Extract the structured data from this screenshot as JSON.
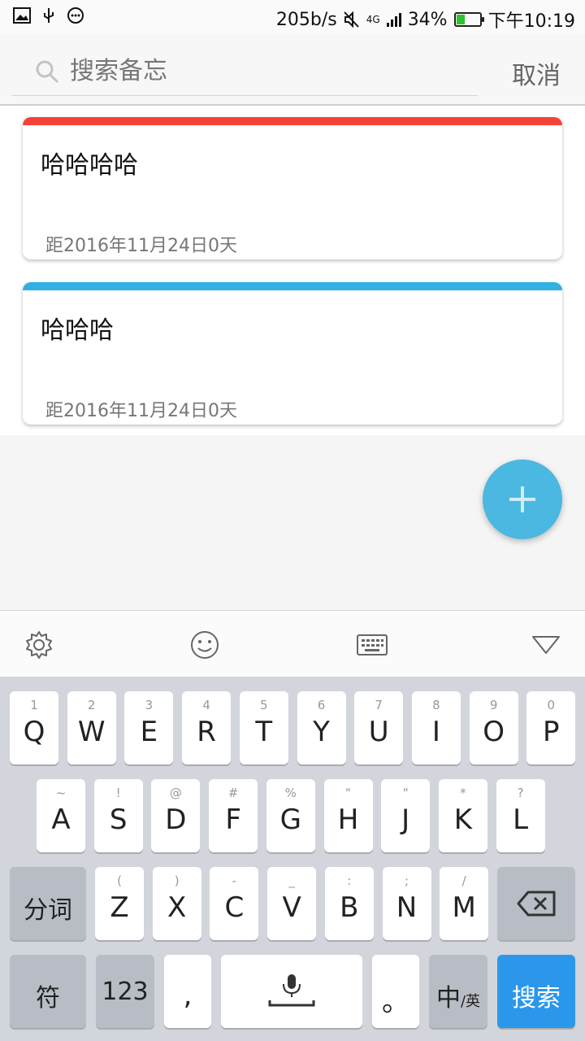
{
  "status_bar": {
    "speed": "205b/s",
    "network": "4G",
    "battery_pct": "34%",
    "battery_level": 0.34,
    "time": "下午10:19"
  },
  "search": {
    "placeholder": "搜索备忘",
    "value": "",
    "cancel_label": "取消"
  },
  "notes": [
    {
      "title": "哈哈哈哈",
      "meta": "距2016年11月24日0天",
      "color": "#f44336"
    },
    {
      "title": "哈哈哈",
      "meta": "距2016年11月24日0天",
      "color": "#2fb1e4"
    }
  ],
  "fab": {
    "icon": "plus-icon",
    "color": "#4ab8e0"
  },
  "keyboard_toolbar": {
    "icons": [
      "gear-icon",
      "emoji-icon",
      "keyboard-icon",
      "collapse-icon"
    ]
  },
  "keyboard": {
    "row1": [
      {
        "hint": "1",
        "key": "Q"
      },
      {
        "hint": "2",
        "key": "W"
      },
      {
        "hint": "3",
        "key": "E"
      },
      {
        "hint": "4",
        "key": "R"
      },
      {
        "hint": "5",
        "key": "T"
      },
      {
        "hint": "6",
        "key": "Y"
      },
      {
        "hint": "7",
        "key": "U"
      },
      {
        "hint": "8",
        "key": "I"
      },
      {
        "hint": "9",
        "key": "O"
      },
      {
        "hint": "0",
        "key": "P"
      }
    ],
    "row2": [
      {
        "hint": "~",
        "key": "A"
      },
      {
        "hint": "!",
        "key": "S"
      },
      {
        "hint": "@",
        "key": "D"
      },
      {
        "hint": "#",
        "key": "F"
      },
      {
        "hint": "%",
        "key": "G"
      },
      {
        "hint": "\"",
        "key": "H"
      },
      {
        "hint": "\"",
        "key": "J"
      },
      {
        "hint": "*",
        "key": "K"
      },
      {
        "hint": "?",
        "key": "L"
      }
    ],
    "row3": [
      {
        "hint": "(",
        "key": "Z"
      },
      {
        "hint": ")",
        "key": "X"
      },
      {
        "hint": "-",
        "key": "C"
      },
      {
        "hint": "_",
        "key": "V"
      },
      {
        "hint": ":",
        "key": "B"
      },
      {
        "hint": ";",
        "key": "N"
      },
      {
        "hint": "/",
        "key": "M"
      }
    ],
    "segment_label": "分词",
    "symbol_label": "符",
    "numeric_label": "123",
    "comma_label": ",",
    "period_label": "。",
    "lang_label_main": "中",
    "lang_label_sub": "/英",
    "search_label": "搜索",
    "accent_color": "#2a97ea"
  }
}
